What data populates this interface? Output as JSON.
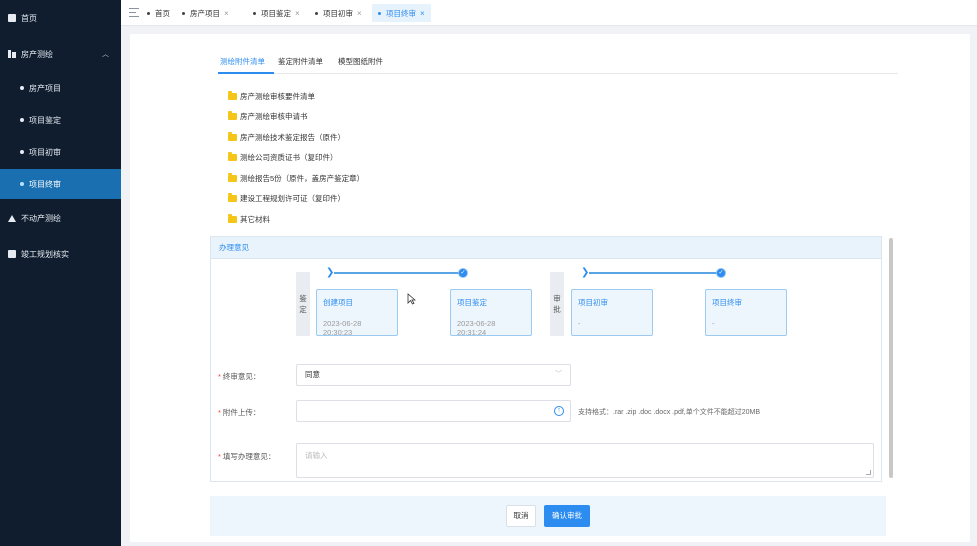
{
  "sidebar": {
    "items": [
      {
        "label": "首页",
        "icon": "square-icon"
      },
      {
        "label": "房产测绘",
        "icon": "building-icon"
      },
      {
        "label": "不动产测绘",
        "icon": "home-icon"
      },
      {
        "label": "竣工规划核实",
        "icon": "square-icon"
      }
    ],
    "sub_items": [
      {
        "label": "房产项目"
      },
      {
        "label": "项目鉴定"
      },
      {
        "label": "项目初审"
      },
      {
        "label": "项目终审"
      }
    ],
    "active_color": "#1a6fb0",
    "bg_color": "#0f1d2e"
  },
  "tabs": [
    {
      "label": "首页",
      "closable": false
    },
    {
      "label": "房产项目",
      "closable": true
    },
    {
      "label": "项目鉴定",
      "closable": true
    },
    {
      "label": "项目初审",
      "closable": true
    },
    {
      "label": "项目终审",
      "closable": true,
      "active": true
    }
  ],
  "tab_close_glyph": "×",
  "subtabs": [
    {
      "label": "测绘附件清单",
      "active": true
    },
    {
      "label": "鉴定附件清单"
    },
    {
      "label": "模型图纸附件"
    }
  ],
  "files": [
    "房产测绘审核要件清单",
    "房产测绘审核申请书",
    "房产测绘技术鉴定报告（原件）",
    "测绘公司资质证书（复印件）",
    "测绘报告5份（原件，盖房产鉴定章）",
    "建设工程规划许可证（复印件）",
    "其它材料"
  ],
  "opinion": {
    "title": "办理意见",
    "stage1_label": "鉴定",
    "stage2_label": "审批",
    "steps": [
      {
        "name": "创建项目",
        "time": "2023-06-28 20:30:23"
      },
      {
        "name": "项目鉴定",
        "time": "2023-06-28 20:31:24"
      },
      {
        "name": "项目初审",
        "time": "-"
      },
      {
        "name": "项目终审",
        "time": "-"
      }
    ]
  },
  "form": {
    "final_opinion_label": "终审意见：",
    "final_opinion_value": "同意",
    "attachment_label": "附件上传：",
    "attachment_hint": "支持格式：.rar .zip .doc .docx .pdf,单个文件不能超过20MB",
    "comment_label": "填写办理意见：",
    "comment_placeholder": "请输入",
    "required_mark": "*"
  },
  "buttons": {
    "cancel": "取消",
    "confirm": "确认审批"
  },
  "accent_color": "#2d8cf0",
  "folder_color": "#f5c518"
}
